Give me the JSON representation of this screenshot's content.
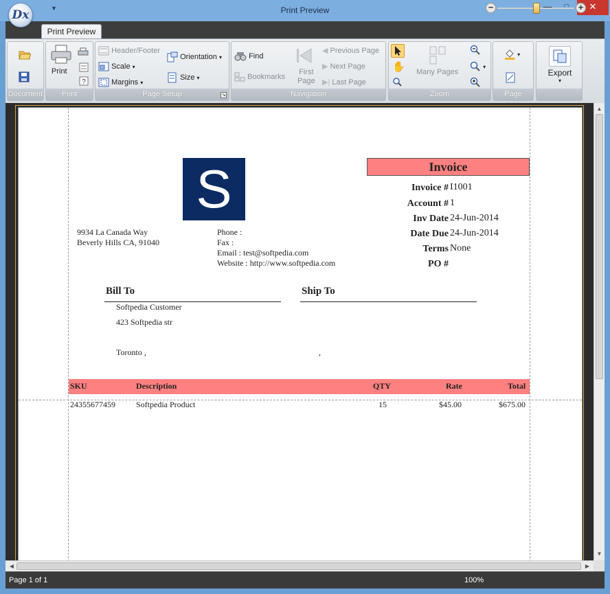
{
  "window": {
    "title": "Print Preview",
    "orb_text": "Dx",
    "min_glyph": "—",
    "max_glyph": "□",
    "close_glyph": "✕"
  },
  "ribbon": {
    "tab": "Print Preview",
    "groups": {
      "document": "Document",
      "print": "Print",
      "page_setup": "Page Setup",
      "navigation": "Navigation",
      "zoom": "Zoom",
      "page_background": "Page Back...",
      "export": ""
    },
    "buttons": {
      "print": "Print",
      "header_footer": "Header/Footer",
      "scale": "Scale",
      "margins": "Margins",
      "orientation": "Orientation",
      "size": "Size",
      "find": "Find",
      "bookmarks": "Bookmarks",
      "first_page_line1": "First",
      "first_page_line2": "Page",
      "previous_page": "Previous Page",
      "next_page": "Next  Page",
      "last_page": "Last  Page",
      "many_pages": "Many Pages",
      "export": "Export"
    }
  },
  "invoice": {
    "logo_letter": "S",
    "title": "Invoice",
    "details": [
      {
        "label": "Invoice #",
        "value": "I1001"
      },
      {
        "label": "Account #",
        "value": "1"
      },
      {
        "label": "Inv Date",
        "value": "24-Jun-2014"
      },
      {
        "label": "Date Due",
        "value": "24-Jun-2014"
      },
      {
        "label": "Terms",
        "value": "None"
      },
      {
        "label": "PO #",
        "value": ""
      }
    ],
    "address_line1": "9934 La Canada Way",
    "address_line2": "Beverly Hills CA, 91040",
    "phone": "Phone   :",
    "fax": "Fax     :",
    "email": "Email  : test@softpedia.com",
    "website": "Website : http://www.softpedia.com",
    "bill_to": {
      "heading": "Bill To",
      "name": "Softpedia Customer",
      "street": "423 Softpedia str",
      "city": "Toronto ,"
    },
    "ship_to": {
      "heading": "Ship To",
      "city": ","
    },
    "table": {
      "headers": {
        "sku": "SKU",
        "description": "Description",
        "qty": "QTY",
        "rate": "Rate",
        "total": "Total"
      },
      "rows": [
        {
          "sku": "24355677459",
          "description": "Softpedia Product",
          "qty": "15",
          "rate": "$45.00",
          "total": "$675.00"
        }
      ]
    }
  },
  "status": {
    "page": "Page 1 of 1",
    "zoom": "100%",
    "zoom_level": 100
  },
  "colors": {
    "accent_pink": "#fe8080",
    "logo_navy": "#0c2b63"
  }
}
